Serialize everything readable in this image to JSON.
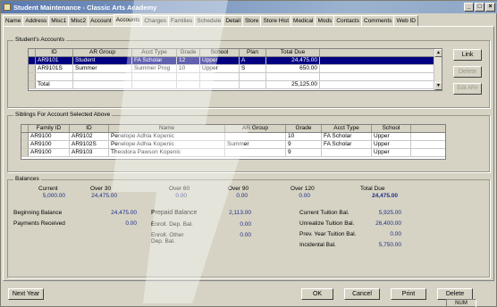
{
  "window": {
    "title": "Student Maintenance - Classic Arts Academy"
  },
  "tabs": [
    "Name",
    "Address",
    "Misc1",
    "Misc2",
    "Account",
    "Accounts",
    "Charges",
    "Families",
    "Schedule",
    "Detail",
    "Store",
    "Store Hist",
    "Medical",
    "Mods",
    "Contacts",
    "Comments",
    "Web ID"
  ],
  "accounts": {
    "label": "Student's Accounts",
    "columns": [
      "ID",
      "AR Group",
      "Acct Type",
      "Grade",
      "School",
      "Plan",
      "Total Due"
    ],
    "rows": [
      [
        "AR9101",
        "Student",
        "FA Scholar",
        "12",
        "Upper",
        "A",
        "24,475.00"
      ],
      [
        "AR9101S",
        "Summer",
        "Summer Prog",
        "10",
        "Upper",
        "S",
        "650.00"
      ],
      [
        "",
        "",
        "",
        "",
        "",
        "",
        ""
      ],
      [
        "Total",
        "",
        "",
        "",
        "",
        "",
        "25,125.00"
      ]
    ],
    "buttons": [
      "Link",
      "Delete",
      "Edit AR#"
    ]
  },
  "siblings": {
    "label": "Siblings For Account Selected Above",
    "columns": [
      "Family ID",
      "ID",
      "Name",
      "AR Group",
      "Grade",
      "Acct Type",
      "School"
    ],
    "rows": [
      [
        "AR9100",
        "AR9102",
        "Penelope Adhia Kopenic",
        "",
        "10",
        "FA Scholar",
        "Upper"
      ],
      [
        "AR9100",
        "AR9102S",
        "Penelope Adhia Kopenic",
        "Summer",
        "9",
        "FA Scholar",
        "Upper"
      ],
      [
        "AR9100",
        "AR9103",
        "Theodora Pawson Kopenic",
        "",
        "9",
        "",
        "Upper"
      ]
    ]
  },
  "balances": {
    "label": "Balances",
    "aging": [
      {
        "label": "Current",
        "value": "5,000.00"
      },
      {
        "label": "Over 30",
        "value": "24,475.00"
      },
      {
        "label": "Over 60",
        "value": "0.00"
      },
      {
        "label": "Over 90",
        "value": "0.00"
      },
      {
        "label": "Over 120",
        "value": "0.00"
      },
      {
        "label": "Total Due",
        "value": "24,475.00"
      }
    ],
    "left": [
      {
        "label": "Beginning Balance",
        "value": "24,475.00"
      },
      {
        "label": "Payments Received",
        "value": "0.00"
      }
    ],
    "middle": [
      {
        "label": "Prepaid Balance",
        "value": "2,113.00"
      },
      {
        "label": "Enroll. Dep. Bal.",
        "value": "0.00"
      },
      {
        "label": "Enroll. Other Dep. Bal.",
        "value": "0.00"
      }
    ],
    "right": [
      {
        "label": "Current Tuition Bal.",
        "value": "5,925.00"
      },
      {
        "label": "Unrealize Tuition Bal.",
        "value": "26,400.00"
      },
      {
        "label": "Prev. Year Tuition Bal.",
        "value": "0.00"
      },
      {
        "label": "Incidental Bal.",
        "value": "5,750.00"
      }
    ]
  },
  "footer": {
    "next_year": "Next Year",
    "ok": "OK",
    "cancel": "Cancel",
    "print": "Print",
    "delete": "Delete",
    "status": "NUM"
  }
}
